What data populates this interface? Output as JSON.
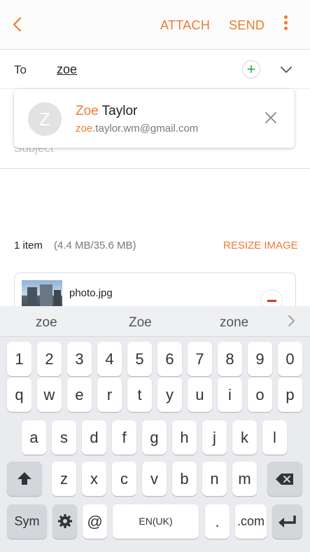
{
  "appbar": {
    "attach": "ATTACH",
    "send": "SEND"
  },
  "to": {
    "label": "To",
    "value": "zoe"
  },
  "subject": {
    "placeholder": "Subject"
  },
  "suggestion": {
    "avatar_letter": "Z",
    "name_match": "Zoe",
    "name_rest": " Taylor",
    "email_match": "zoe",
    "email_rest": ".taylor.wm@gmail.com"
  },
  "attachments": {
    "count": "1 item",
    "size": "(4.4 MB/35.6 MB)",
    "resize": "RESIZE IMAGE",
    "files": [
      {
        "name": "photo.jpg"
      }
    ]
  },
  "keyboard": {
    "predictions": [
      "zoe",
      "Zoe",
      "zone"
    ],
    "row1": [
      "1",
      "2",
      "3",
      "4",
      "5",
      "6",
      "7",
      "8",
      "9",
      "0"
    ],
    "row2": [
      "q",
      "w",
      "e",
      "r",
      "t",
      "y",
      "u",
      "i",
      "o",
      "p"
    ],
    "row3": [
      "a",
      "s",
      "d",
      "f",
      "g",
      "h",
      "j",
      "k",
      "l"
    ],
    "row4": [
      "z",
      "x",
      "c",
      "v",
      "b",
      "n",
      "m"
    ],
    "sym": "Sym",
    "at": "@",
    "space": "EN(UK)",
    "period": ".",
    "dotcom": ".com"
  },
  "colors": {
    "accent": "#ef7a2f",
    "add_green": "#3aa53a",
    "remove_red": "#e0322f"
  },
  "icons": [
    "back-arrow-icon",
    "more-vert-icon",
    "add-icon",
    "chevron-down-icon",
    "close-icon",
    "remove-icon",
    "chevron-right-icon",
    "shift-icon",
    "gear-icon",
    "backspace-icon",
    "enter-icon"
  ]
}
